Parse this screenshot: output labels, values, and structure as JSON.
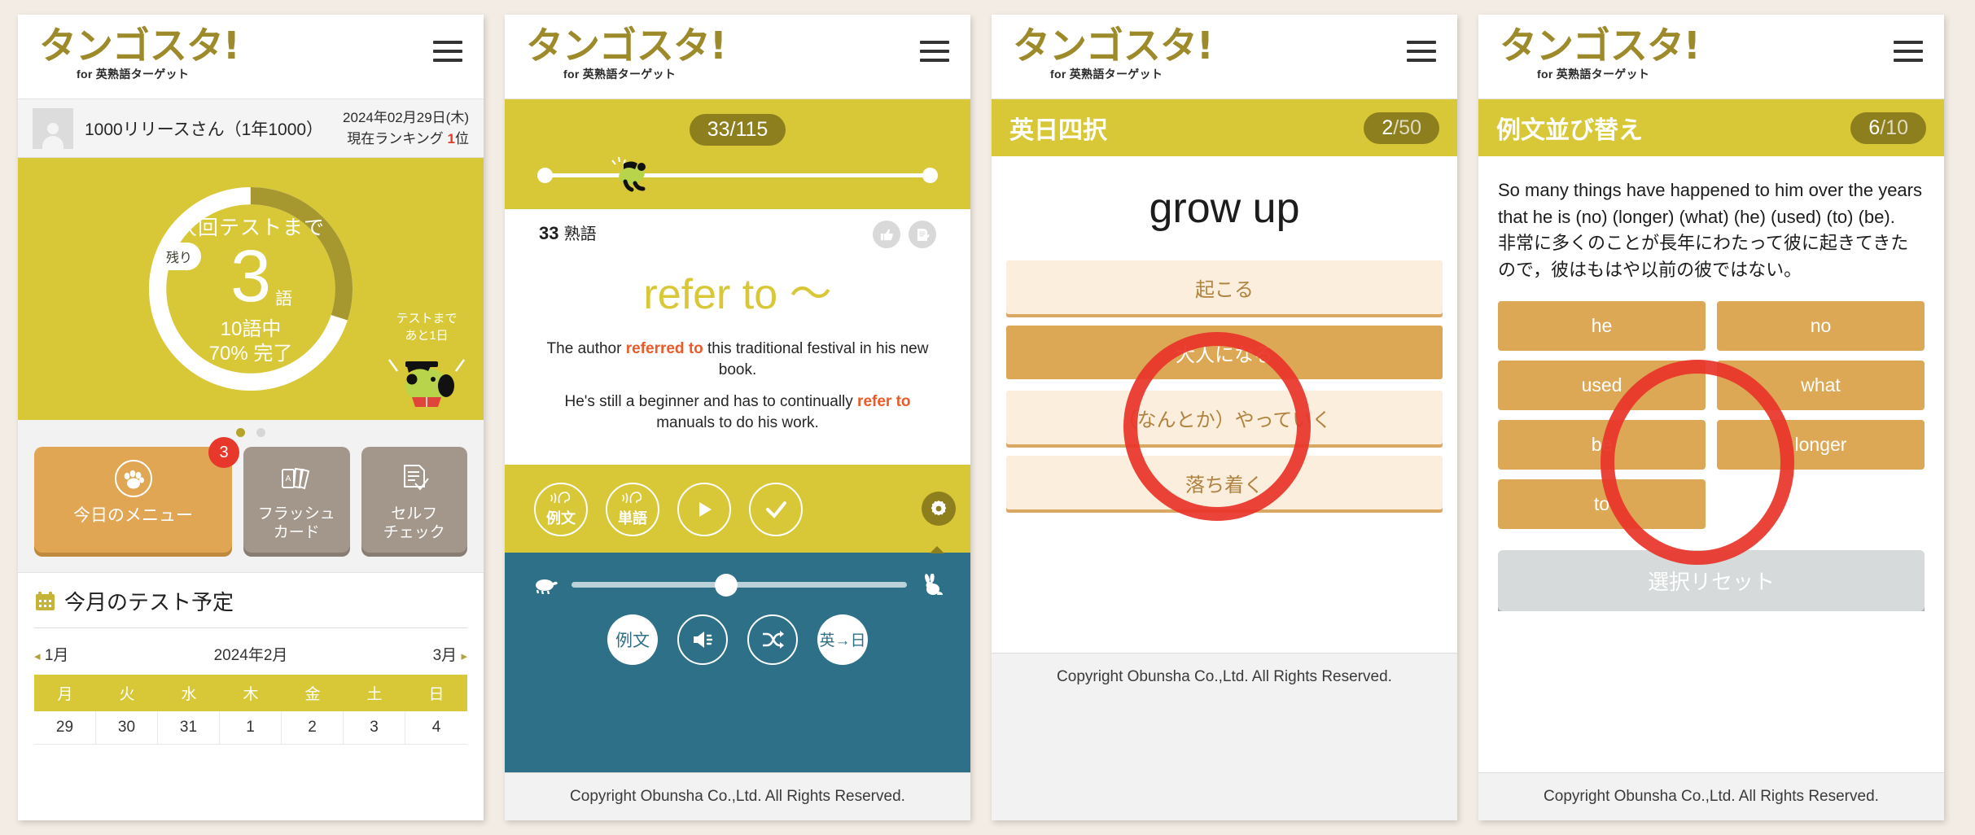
{
  "app": {
    "logo": "タンゴスタ!",
    "logo_sub": "for 英熟語ターゲット",
    "footer": "Copyright Obunsha Co.,Ltd. All Rights Reserved."
  },
  "panel1": {
    "user_name": "1000リリースさん（1年1000）",
    "date": "2024年02月29日(木)",
    "rank_prefix": "現在ランキング",
    "rank_value": "1",
    "rank_suffix": "位",
    "ring": {
      "bubble": "残り",
      "top_label": "次回テストまで",
      "big_number": "3",
      "big_unit": "語",
      "bottom_line1": "10語中",
      "bottom_line2": "70% 完了",
      "percent": 70
    },
    "dog_note_line1": "テストまで",
    "dog_note_line2": "あと1日",
    "menu": [
      {
        "label": "今日のメニュー",
        "badge": "3",
        "icon": "paw-icon"
      },
      {
        "label": "フラッシュ\nカード",
        "icon": "cards-icon"
      },
      {
        "label": "セルフ\nチェック",
        "icon": "checklist-icon"
      }
    ],
    "menu_labels": {
      "today": "今日のメニュー",
      "flash_l1": "フラッシュ",
      "flash_l2": "カード",
      "self_l1": "セルフ",
      "self_l2": "チェック",
      "badge": "3"
    },
    "calendar": {
      "title": "今月のテスト予定",
      "prev": "1月",
      "current": "2024年2月",
      "next": "3月",
      "weekdays": [
        "月",
        "火",
        "水",
        "木",
        "金",
        "土",
        "日"
      ],
      "days": [
        "29",
        "30",
        "31",
        "1",
        "2",
        "3",
        "4"
      ]
    }
  },
  "panel2": {
    "progress_chip": "33/115",
    "card_number": "33",
    "card_unit": "熟語",
    "word": "refer to 〜",
    "examples": [
      {
        "pre": "The author ",
        "hl": "referred to",
        "post": " this traditional festival in his new book."
      },
      {
        "pre": "He's still a beginner and has to continually ",
        "hl": "refer to",
        "post": " manuals to do his work."
      }
    ],
    "controls": [
      {
        "label": "例文",
        "icon": "listen-icon"
      },
      {
        "label": "単語",
        "icon": "listen-icon"
      },
      {
        "label": "",
        "icon": "play-icon"
      },
      {
        "label": "",
        "icon": "check-icon"
      }
    ],
    "control_labels": {
      "c1": "例文",
      "c2": "単語"
    },
    "gear_icon": "gear-icon",
    "speed": {
      "slow_icon": "turtle-icon",
      "fast_icon": "rabbit-icon",
      "value": 46
    },
    "teal_buttons": [
      {
        "label": "例文",
        "icon": "text-icon"
      },
      {
        "label": "",
        "icon": "speaker-icon"
      },
      {
        "label": "",
        "icon": "shuffle-icon"
      },
      {
        "label": "英→日",
        "icon": "direction-icon"
      }
    ],
    "teal_labels": {
      "b1": "例文",
      "b4": "英→日"
    }
  },
  "panel3": {
    "title": "英日四択",
    "counter_num": "2",
    "counter_den": "/50",
    "question": "grow up",
    "choices": [
      "起こる",
      "大人になる",
      "（なんとか）やっていく",
      "落ち着く"
    ],
    "selected_index": 1
  },
  "panel4": {
    "title": "例文並び替え",
    "counter_num": "6",
    "counter_den": "/10",
    "sentence_en": "So many things have happened to him over the years that he is (no) (longer) (what) (he) (used) (to) (be).",
    "sentence_ja": "非常に多くのことが長年にわたって彼に起きてきたので，彼はもはや以前の彼ではない。",
    "tiles": [
      "he",
      "no",
      "used",
      "what",
      "be",
      "longer",
      "to"
    ],
    "reset_label": "選択リセット"
  },
  "colors": {
    "brand_yellow": "#d8c838",
    "brand_olive": "#8e7f1e",
    "accent_orange": "#dda855",
    "teal": "#2e7087",
    "highlight_red": "#e8352a",
    "page_bg": "#f2ece4"
  }
}
